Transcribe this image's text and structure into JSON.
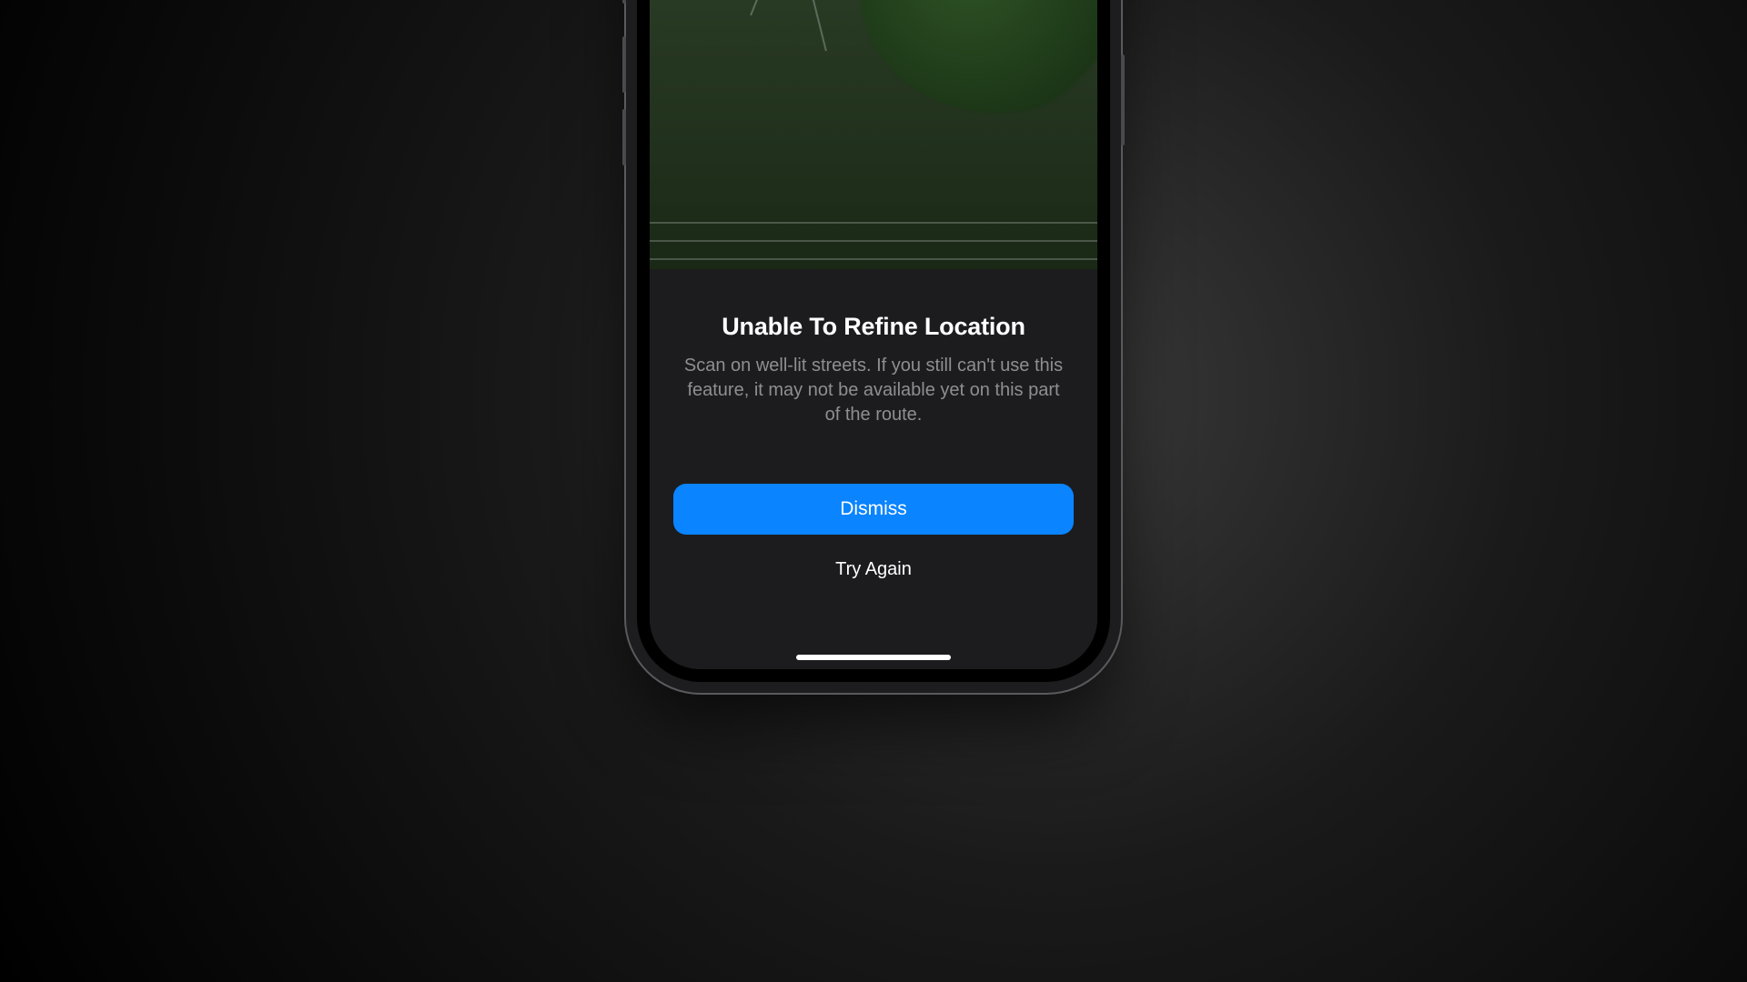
{
  "sheet": {
    "title": "Unable To Refine Location",
    "body": "Scan on well-lit streets. If you still can't use this feature, it may not be available yet on this part of the route.",
    "primary": "Dismiss",
    "secondary": "Try Again"
  },
  "colors": {
    "accent": "#0a84ff",
    "sheet_bg": "#1c1c1e",
    "body_text": "#8e8e93"
  }
}
